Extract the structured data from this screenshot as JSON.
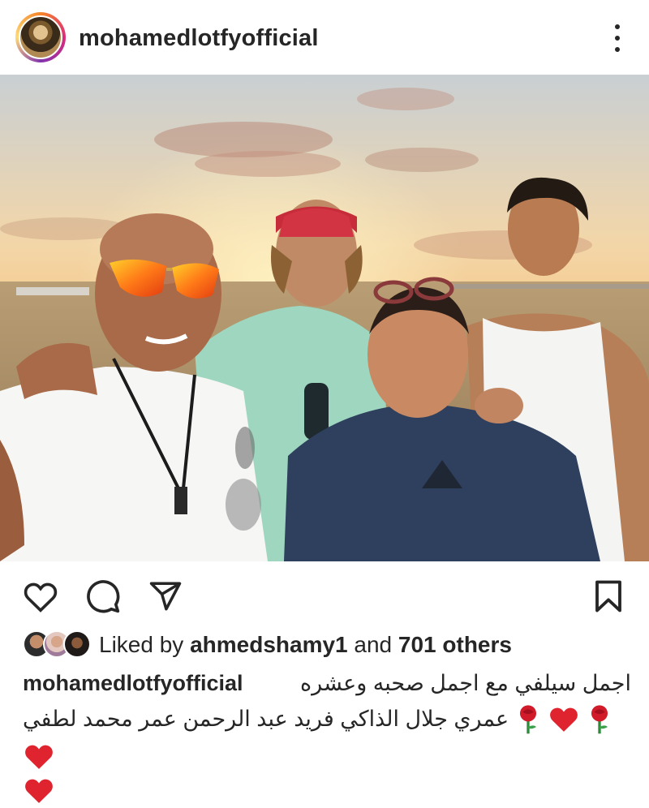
{
  "post": {
    "username": "mohamedlotfyofficial",
    "more_icon": "more-vertical-icon"
  },
  "actions": {
    "like_icon": "heart-outline-icon",
    "comment_icon": "comment-icon",
    "share_icon": "send-icon",
    "save_icon": "bookmark-icon"
  },
  "likes": {
    "prefix": "Liked by",
    "user": "ahmedshamy1",
    "conjunction": "and",
    "count_text": "701 others"
  },
  "caption": {
    "username": "mohamedlotfyofficial",
    "line1": "اجمل سيلفي مع اجمل صحبه وعشره",
    "line2_text": "عمري جلال الذاكي فريد عبد الرحمن عمر محمد لطفي",
    "emoji_sequence": [
      "red-heart-emoji",
      "rose-emoji",
      "red-heart-emoji",
      "rose-emoji",
      "red-heart-emoji"
    ]
  },
  "colors": {
    "text": "#262626",
    "heart": "#e0242f",
    "rose": "#d11a2a"
  }
}
